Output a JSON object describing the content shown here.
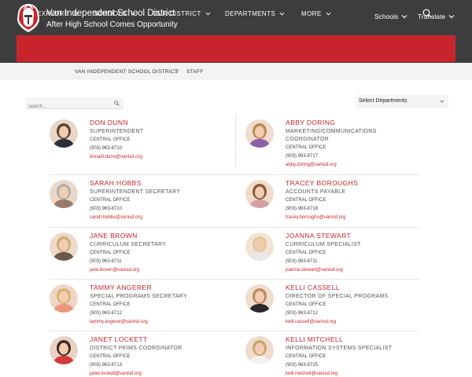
{
  "header": {
    "site_title": "Van Independent School District",
    "tagline": "After High School Comes Opportunity",
    "util_schools": "Schools",
    "util_translate": "Translate"
  },
  "nav": {
    "items": [
      "EXPLORE",
      "SCHOOLS",
      "OUR DISTRICT",
      "DEPARTMENTS",
      "MORE"
    ]
  },
  "breadcrumb": {
    "home": "VAN INDEPENDENT SCHOOL DISTRICT",
    "sep": "//",
    "current": "STAFF"
  },
  "search": {
    "placeholder": "search..."
  },
  "department_select": {
    "selected": "Select Departments"
  },
  "staff": [
    {
      "name": "DON DUNN",
      "title": "SUPERINTENDENT",
      "office": "CENTRAL OFFICE",
      "phone": "(903) 963-8710",
      "email": "donald.dunn@vanisd.org"
    },
    {
      "name": "ABBY DORING",
      "title": "MARKETING/COMMUNICATIONS COORDINATOR",
      "office": "CENTRAL OFFICE",
      "phone": "(903) 963-8717",
      "email": "abby.doring@vanisd.org"
    },
    {
      "name": "SARAH HOBBS",
      "title": "SUPERINTENDENT SECRETARY",
      "office": "CENTRAL OFFICE",
      "phone": "(903) 963-8710",
      "email": "sarah.hobbs@vanisd.org"
    },
    {
      "name": "TRACEY BOROUGHS",
      "title": "ACCOUNTS PAYABLE",
      "office": "CENTRAL OFFICE",
      "phone": "(903) 963-8718",
      "email": "tracey.boroughs@vanisd.org"
    },
    {
      "name": "JANE BROWN",
      "title": "CURRICULUM SECRETARY",
      "office": "CENTRAL OFFICE",
      "phone": "(903) 963-8711",
      "email": "jane.brown@vanisd.org"
    },
    {
      "name": "JOANNA STEWART",
      "title": "CURRICULUM SPECIALIST",
      "office": "CENTRAL OFFICE",
      "phone": "(903) 963-8711",
      "email": "joanna.stewart@vanisd.org"
    },
    {
      "name": "TAMMY ANGERER",
      "title": "SPECIAL PROGRAMS SECRETARY",
      "office": "CENTRAL OFFICE",
      "phone": "(903) 963-8712",
      "email": "tammy.angerer@vanisd.org"
    },
    {
      "name": "KELLI CASSELL",
      "title": "DIRECTOR OF SPECIAL PROGRAMS",
      "office": "CENTRAL OFFICE",
      "phone": "(903) 963-8712",
      "email": "kelli.cassell@vanisd.org"
    },
    {
      "name": "JANET LOCKETT",
      "title": "DISTRICT PEIMS COORDINATOR",
      "office": "CENTRAL OFFICE",
      "phone": "(903) 963-8713",
      "email": "janet.lockett@vanisd.org"
    },
    {
      "name": "KELLI MITCHELL",
      "title": "INFORMATION SYSTEMS SPECIALIST",
      "office": "CENTRAL OFFICE",
      "phone": "(903) 963-8725",
      "email": "kelli.mitchell@vanisd.org"
    }
  ],
  "colors": {
    "brand_red": "#c8242c",
    "header_bg": "#3d3d3d"
  }
}
